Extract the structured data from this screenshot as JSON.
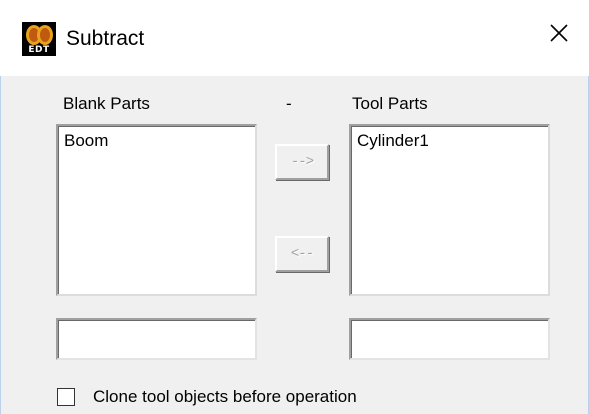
{
  "window": {
    "title": "Subtract",
    "icon": "edt-app-icon",
    "icon_label": "EDT",
    "close_icon": "close-icon"
  },
  "labels": {
    "blank_parts": "Blank Parts",
    "separator": "-",
    "tool_parts": "Tool Parts"
  },
  "blank_list": {
    "items": [
      "Boom"
    ]
  },
  "tool_list": {
    "items": [
      "Cylinder1"
    ]
  },
  "buttons": {
    "move_right": "-->",
    "move_left": "<--"
  },
  "blank_input": {
    "value": ""
  },
  "tool_input": {
    "value": ""
  },
  "clone_option": {
    "label": "Clone tool objects before operation",
    "checked": false
  },
  "colors": {
    "title_bg": "#ffffff",
    "client_bg": "#f0f0f0",
    "disabled_text": "#a0a0a0"
  }
}
